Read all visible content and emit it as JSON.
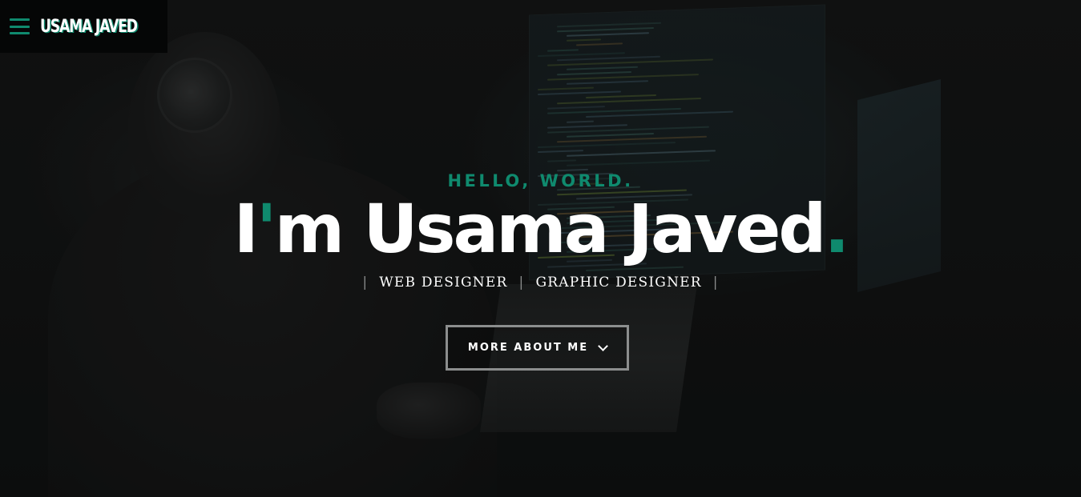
{
  "brand": {
    "name": "USAMA JAVED",
    "accent_color": "#0f8a6e",
    "menu_icon": "hamburger-menu-icon"
  },
  "hero": {
    "greeting": "HELLO, WORLD.",
    "headline_prefix": "I",
    "headline_apostrophe": "'",
    "headline_rest": "m Usama Javed",
    "headline_dot": ".",
    "roles": [
      "WEB DESIGNER",
      "GRAPHIC DESIGNER"
    ],
    "role_separator": "|",
    "cta_label": "MORE ABOUT ME",
    "cta_icon": "chevron-down-icon"
  }
}
